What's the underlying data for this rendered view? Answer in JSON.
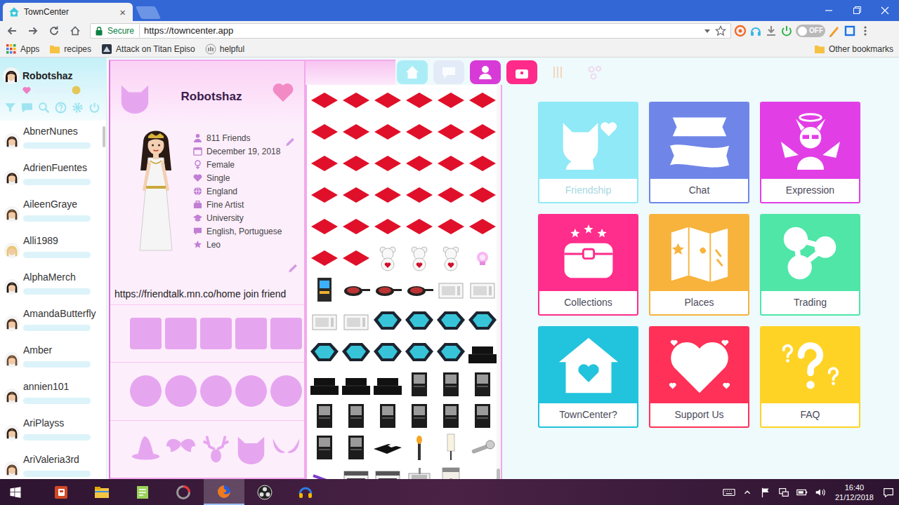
{
  "browser": {
    "tabs": [
      {
        "label": "TownCenter",
        "close": "×",
        "selected": true
      }
    ],
    "security": "Secure",
    "url": "https://towncenter.app",
    "extension_toggle": {
      "label": "OFF",
      "on": false
    },
    "bookmarks": [
      "Apps",
      "recipes",
      "Attack on Titan Episo",
      "helpful"
    ],
    "other_bookmarks": "Other bookmarks"
  },
  "sidebar": {
    "user": "Robotshaz",
    "friends": [
      "AbnerNunes",
      "AdrienFuentes",
      "AileenGraye",
      "Alli1989",
      "AlphaMerch",
      "AmandaButterfly",
      "Amber",
      "annien101",
      "AriPlayss",
      "AriValeria3rd"
    ]
  },
  "profile": {
    "name": "Robotshaz",
    "details": [
      {
        "text": "811 Friends",
        "kind": "friends"
      },
      {
        "text": "December 19, 2018",
        "kind": "date"
      },
      {
        "text": "Female",
        "kind": "gender"
      },
      {
        "text": "Single",
        "kind": "relationship"
      },
      {
        "text": "England",
        "kind": "country"
      },
      {
        "text": "Fine Artist",
        "kind": "job"
      },
      {
        "text": "University",
        "kind": "education"
      },
      {
        "text": "English, Portuguese",
        "kind": "language"
      },
      {
        "text": "Leo",
        "kind": "sign"
      }
    ],
    "status": "https://friendtalk.mn.co/home join friend"
  },
  "inventory": {
    "tabs": [
      {
        "color": "#8fe8f5",
        "selected": false,
        "disabled": false
      },
      {
        "color": "#dfe6f7",
        "selected": false,
        "disabled": false
      },
      {
        "color": "#d83ad8",
        "selected": true,
        "disabled": false
      },
      {
        "color": "#ff2a8a",
        "selected": true,
        "disabled": false
      },
      {
        "color": "#f6c7a0",
        "selected": false,
        "disabled": true
      },
      {
        "color": "#f3c0e6",
        "selected": false,
        "disabled": true
      }
    ],
    "items": [
      {
        "kind": "diamond"
      },
      {
        "kind": "diamond"
      },
      {
        "kind": "diamond"
      },
      {
        "kind": "diamond"
      },
      {
        "kind": "diamond"
      },
      {
        "kind": "diamond"
      },
      {
        "kind": "diamond"
      },
      {
        "kind": "diamond"
      },
      {
        "kind": "diamond"
      },
      {
        "kind": "diamond"
      },
      {
        "kind": "diamond"
      },
      {
        "kind": "diamond"
      },
      {
        "kind": "diamond"
      },
      {
        "kind": "diamond"
      },
      {
        "kind": "diamond"
      },
      {
        "kind": "diamond"
      },
      {
        "kind": "diamond"
      },
      {
        "kind": "diamond"
      },
      {
        "kind": "diamond"
      },
      {
        "kind": "diamond"
      },
      {
        "kind": "diamond"
      },
      {
        "kind": "diamond"
      },
      {
        "kind": "diamond"
      },
      {
        "kind": "diamond"
      },
      {
        "kind": "diamond"
      },
      {
        "kind": "diamond"
      },
      {
        "kind": "diamond"
      },
      {
        "kind": "diamond"
      },
      {
        "kind": "diamond"
      },
      {
        "kind": "diamond"
      },
      {
        "kind": "diamond"
      },
      {
        "kind": "diamond"
      },
      {
        "kind": "teddy"
      },
      {
        "kind": "teddy"
      },
      {
        "kind": "teddy"
      },
      {
        "kind": "lamp"
      },
      {
        "kind": "arcade"
      },
      {
        "kind": "pan"
      },
      {
        "kind": "pan"
      },
      {
        "kind": "pan"
      },
      {
        "kind": "microwave"
      },
      {
        "kind": "microwave"
      },
      {
        "kind": "microwave"
      },
      {
        "kind": "microwave"
      },
      {
        "kind": "hottub"
      },
      {
        "kind": "hottub"
      },
      {
        "kind": "hottub"
      },
      {
        "kind": "hottub"
      },
      {
        "kind": "hottub"
      },
      {
        "kind": "hottub"
      },
      {
        "kind": "hottub"
      },
      {
        "kind": "hottub"
      },
      {
        "kind": "hottub"
      },
      {
        "kind": "sofa"
      },
      {
        "kind": "sofa"
      },
      {
        "kind": "sofa"
      },
      {
        "kind": "sofa"
      },
      {
        "kind": "cabinet"
      },
      {
        "kind": "cabinet"
      },
      {
        "kind": "cabinet"
      },
      {
        "kind": "cabinet"
      },
      {
        "kind": "cabinet"
      },
      {
        "kind": "cabinet"
      },
      {
        "kind": "cabinet"
      },
      {
        "kind": "cabinet"
      },
      {
        "kind": "cabinet"
      },
      {
        "kind": "cabinet"
      },
      {
        "kind": "cabinet"
      },
      {
        "kind": "bed"
      },
      {
        "kind": "torch"
      },
      {
        "kind": "floorlamp"
      },
      {
        "kind": "microphone"
      },
      {
        "kind": "wand"
      },
      {
        "kind": "stove"
      },
      {
        "kind": "stove"
      },
      {
        "kind": "sink"
      },
      {
        "kind": "counter"
      }
    ]
  },
  "menu": {
    "tiles": [
      {
        "label": "Friendship",
        "color": "#8fe9f7",
        "disabled": true
      },
      {
        "label": "Chat",
        "color": "#6f86e8",
        "disabled": false
      },
      {
        "label": "Expression",
        "color": "#e23ee6",
        "disabled": false
      },
      {
        "label": "Collections",
        "color": "#ff2d8c",
        "disabled": false
      },
      {
        "label": "Places",
        "color": "#f7b33c",
        "disabled": false
      },
      {
        "label": "Trading",
        "color": "#4fe6a8",
        "disabled": false
      },
      {
        "label": "TownCenter?",
        "color": "#22c3dc",
        "disabled": false
      },
      {
        "label": "Support Us",
        "color": "#ff3158",
        "disabled": false
      },
      {
        "label": "FAQ",
        "color": "#ffd326",
        "disabled": false
      }
    ]
  },
  "taskbar": {
    "apps": [
      {
        "selected": false
      },
      {
        "selected": false
      },
      {
        "selected": false
      },
      {
        "selected": false
      },
      {
        "selected": true
      },
      {
        "selected": false
      },
      {
        "selected": false
      }
    ],
    "time": "16:40",
    "date": "21/12/2018"
  }
}
